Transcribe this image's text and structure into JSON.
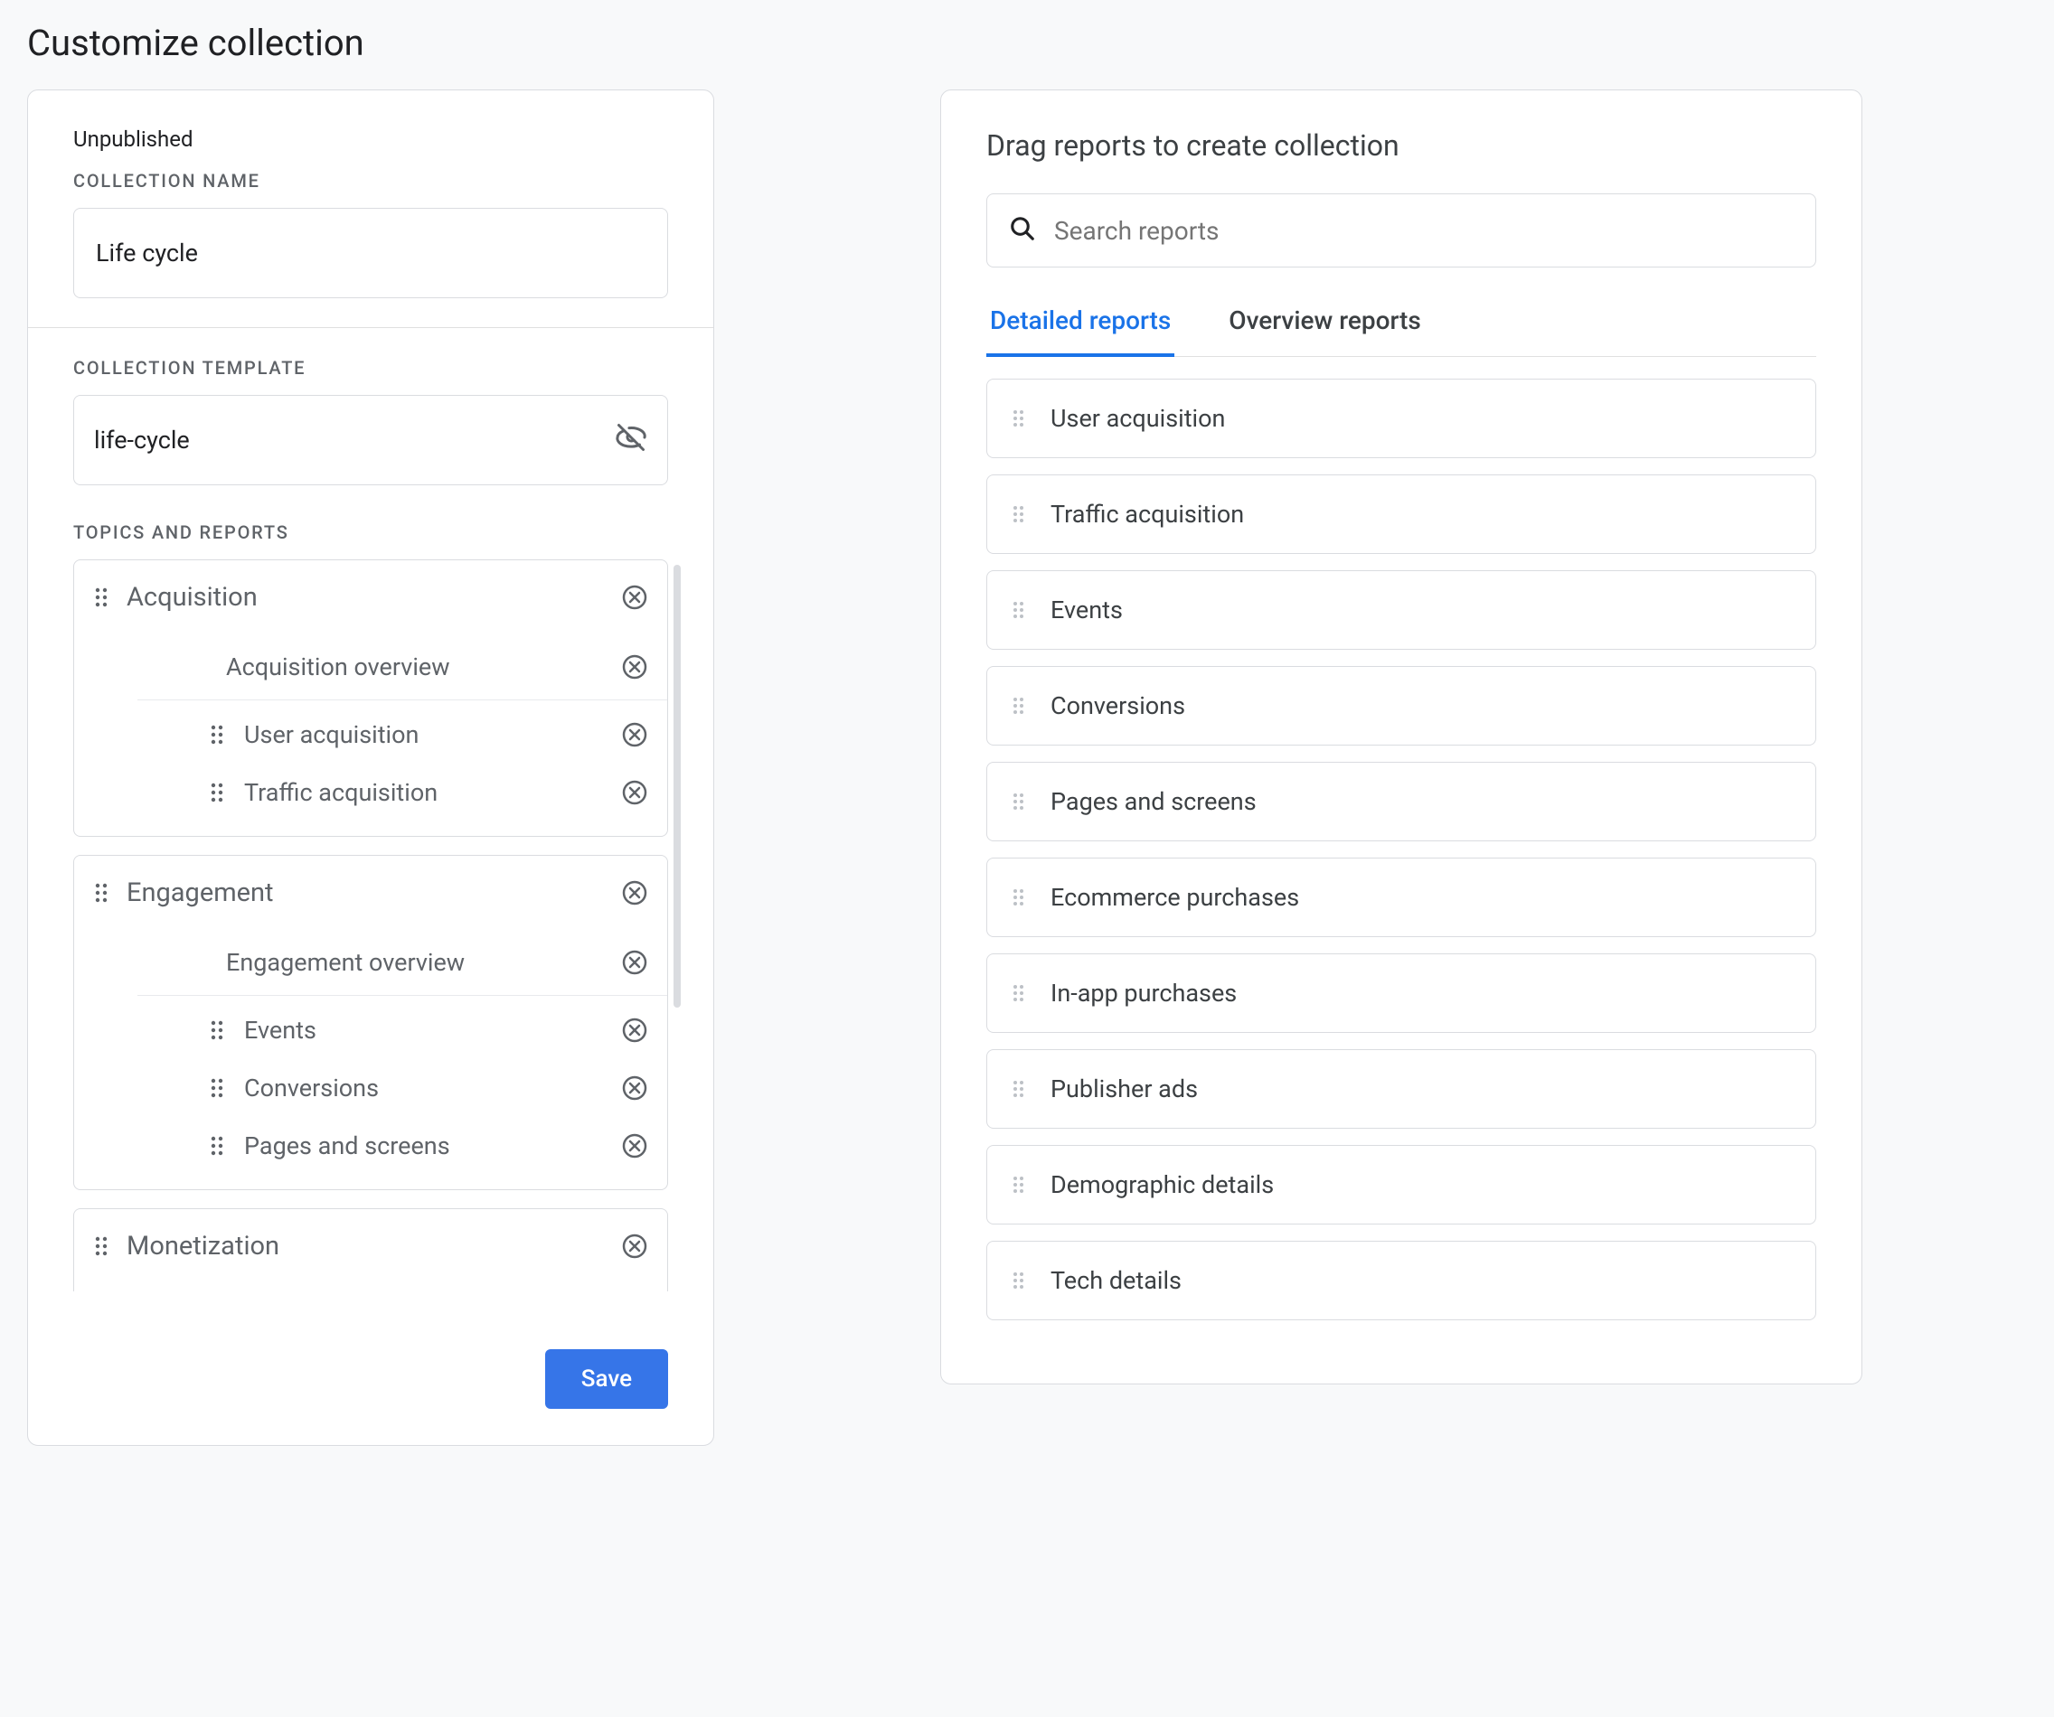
{
  "page_title": "Customize collection",
  "collection": {
    "status": "Unpublished",
    "name_label": "COLLECTION NAME",
    "name_value": "Life cycle",
    "template_label": "COLLECTION TEMPLATE",
    "template_value": "life-cycle",
    "topics_label": "TOPICS AND REPORTS",
    "topics": [
      {
        "title": "Acquisition",
        "overview": "Acquisition overview",
        "reports": [
          "User acquisition",
          "Traffic acquisition"
        ]
      },
      {
        "title": "Engagement",
        "overview": "Engagement overview",
        "reports": [
          "Events",
          "Conversions",
          "Pages and screens"
        ]
      },
      {
        "title": "Monetization",
        "overview": "",
        "reports": []
      }
    ],
    "save_label": "Save"
  },
  "right": {
    "title": "Drag reports to create collection",
    "search_placeholder": "Search reports",
    "tabs": [
      "Detailed reports",
      "Overview reports"
    ],
    "active_tab": 0,
    "available_reports": [
      "User acquisition",
      "Traffic acquisition",
      "Events",
      "Conversions",
      "Pages and screens",
      "Ecommerce purchases",
      "In-app purchases",
      "Publisher ads",
      "Demographic details",
      "Tech details"
    ]
  }
}
